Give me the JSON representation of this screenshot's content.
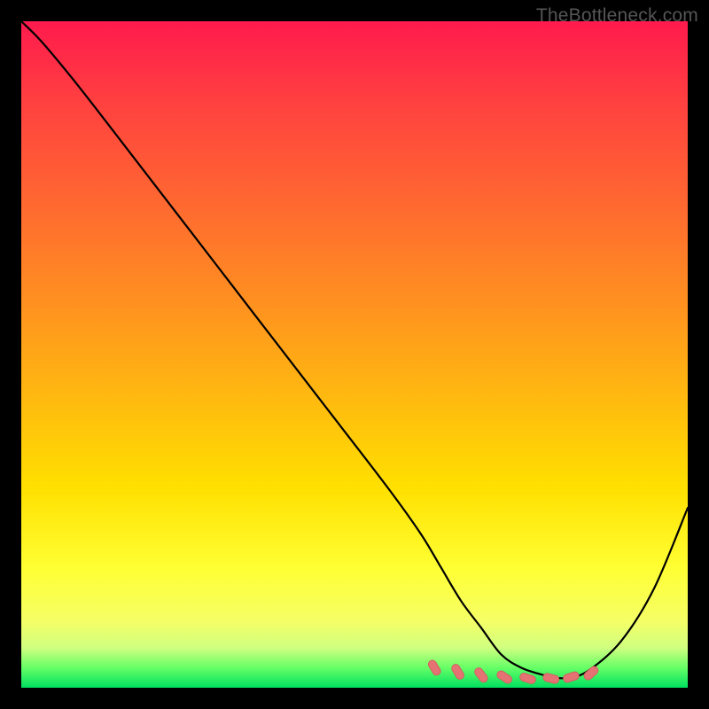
{
  "watermark": {
    "text": "TheBottleneck.com"
  },
  "colors": {
    "background": "#000000",
    "curve": "#000000",
    "marker_fill": "#e57373",
    "marker_stroke": "#d46060",
    "gradient_top": "#ff1a4d",
    "gradient_bottom": "#00e060"
  },
  "chart_data": {
    "type": "line",
    "title": "",
    "xlabel": "",
    "ylabel": "",
    "xlim": [
      0,
      100
    ],
    "ylim": [
      0,
      100
    ],
    "grid": false,
    "series": [
      {
        "name": "bottleneck-curve",
        "x": [
          0,
          3,
          8,
          15,
          25,
          35,
          45,
          55,
          60,
          63,
          66,
          69,
          72,
          75,
          78,
          80,
          82,
          85,
          90,
          95,
          100
        ],
        "values": [
          100,
          97,
          91,
          82,
          69,
          56,
          43,
          30,
          23,
          18,
          13,
          9,
          5,
          3,
          2,
          1.5,
          1.5,
          2.5,
          7,
          15,
          27
        ]
      }
    ],
    "markers": {
      "name": "optimal-range",
      "shape": "rounded-dash",
      "x": [
        62,
        65.5,
        69,
        72.5,
        76,
        79.5,
        82.5,
        85.5
      ],
      "values": [
        3.0,
        2.4,
        1.9,
        1.6,
        1.4,
        1.4,
        1.6,
        2.2
      ]
    }
  }
}
